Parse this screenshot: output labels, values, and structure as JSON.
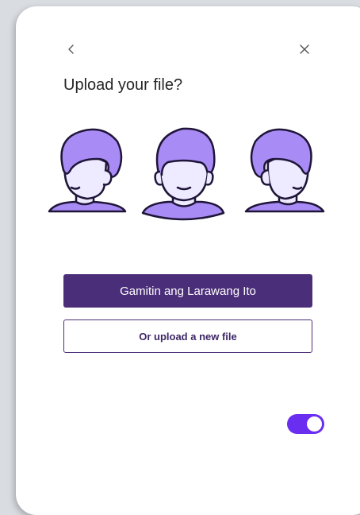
{
  "dialog": {
    "title": "Upload your file?",
    "back_icon": "chevron-left-icon",
    "close_icon": "close-icon"
  },
  "actions": {
    "primary_label": "Gamitin ang Larawang Ito",
    "secondary_label": "Or upload a new file"
  },
  "toggle": {
    "state": "on"
  },
  "colors": {
    "primary": "#4b2e79",
    "accent_toggle": "#6a2ef0",
    "hair": "#a98bf5",
    "face": "#eeeaff",
    "outline": "#1e1538"
  }
}
